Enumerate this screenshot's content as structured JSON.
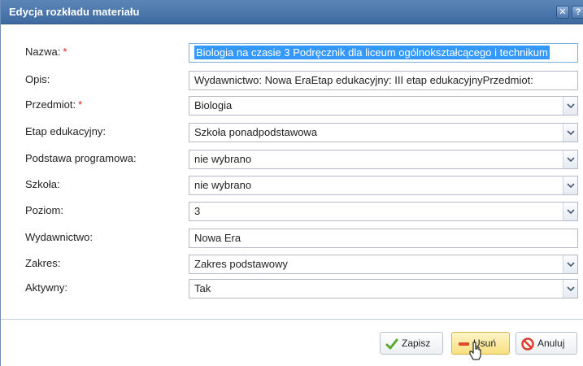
{
  "window": {
    "title": "Edycja rozkładu materiału",
    "close_icon": "close-icon",
    "help_icon": "help-icon"
  },
  "form": {
    "nazwa": {
      "label": "Nazwa:",
      "required_mark": "*",
      "value": "Biologia na czasie 3 Podręcznik dla liceum ogólnokształcącego i technikum"
    },
    "opis": {
      "label": "Opis:",
      "value": "Wydawnictwo:   Nowa EraEtap edukacyjny:  III etap edukacyjnyPrzedmiot:"
    },
    "przedmiot": {
      "label": "Przedmiot:",
      "required_mark": "*",
      "value": "Biologia"
    },
    "etap": {
      "label": "Etap edukacyjny:",
      "value": "Szkoła ponadpodstawowa"
    },
    "podstawa": {
      "label": "Podstawa programowa:",
      "value": "nie wybrano"
    },
    "szkola": {
      "label": "Szkoła:",
      "value": "nie wybrano"
    },
    "poziom": {
      "label": "Poziom:",
      "value": "3"
    },
    "wydawnictwo": {
      "label": "Wydawnictwo:",
      "value": "Nowa Era"
    },
    "zakres": {
      "label": "Zakres:",
      "value": "Zakres podstawowy"
    },
    "aktywny": {
      "label": "Aktywny:",
      "value": "Tak"
    }
  },
  "buttons": {
    "save": "Zapisz",
    "delete": "Usuń",
    "cancel": "Anuluj"
  },
  "colors": {
    "titlebar": "#4a76ab",
    "required": "#d9251d",
    "selection": "#3399ff",
    "save_icon": "#5aa832",
    "delete_icon": "#e04a2a",
    "cancel_icon": "#e03a2a"
  }
}
